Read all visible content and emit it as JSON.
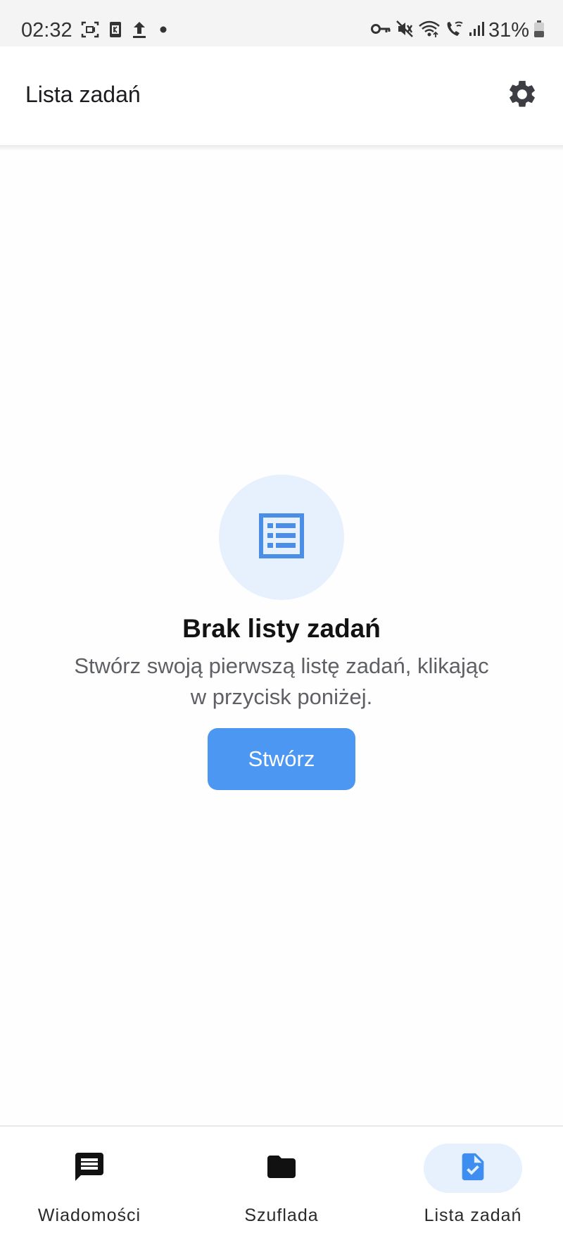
{
  "status_bar": {
    "time": "02:32",
    "battery": "31%"
  },
  "app_bar": {
    "title": "Lista zadań",
    "settings_icon": "gear-icon"
  },
  "empty_state": {
    "icon": "list-document-icon",
    "title": "Brak listy zadań",
    "subtitle": "Stwórz swoją pierwszą listę zadań, klikając w przycisk poniżej.",
    "button_label": "Stwórz"
  },
  "bottom_nav": {
    "items": [
      {
        "label": "Wiadomości",
        "icon": "message-icon",
        "active": false
      },
      {
        "label": "Szuflada",
        "icon": "folder-icon",
        "active": false
      },
      {
        "label": "Lista zadań",
        "icon": "task-document-icon",
        "active": true
      }
    ]
  },
  "colors": {
    "accent": "#4c97f2",
    "accent_light": "#e6f1fd",
    "background": "#fefefe"
  }
}
